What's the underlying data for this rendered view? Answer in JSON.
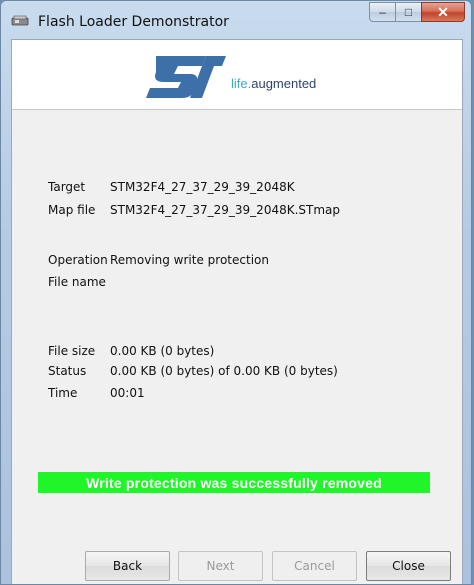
{
  "window": {
    "title": "Flash Loader Demonstrator",
    "icon": "flash-loader-icon"
  },
  "banner": {
    "logo": "st-logo",
    "tagline_part1": "life.",
    "tagline_part2": "augmented"
  },
  "info": {
    "target_label": "Target",
    "target_value": "STM32F4_27_37_29_39_2048K",
    "mapfile_label": "Map file",
    "mapfile_value": "STM32F4_27_37_29_39_2048K.STmap",
    "operation_label": "Operation",
    "operation_value": "Removing write protection",
    "filename_label": "File name",
    "filename_value": "",
    "filesize_label": "File size",
    "filesize_value": "0.00 KB (0 bytes)",
    "status_label": "Status",
    "status_value": "0.00 KB (0 bytes) of 0.00 KB (0 bytes)",
    "time_label": "Time",
    "time_value": "00:01"
  },
  "status_message": "Write protection was successfully removed",
  "buttons": {
    "back": "Back",
    "next": "Next",
    "cancel": "Cancel",
    "close": "Close"
  },
  "colors": {
    "success_bar": "#20f52a",
    "logo_blue": "#3d6fa8"
  }
}
